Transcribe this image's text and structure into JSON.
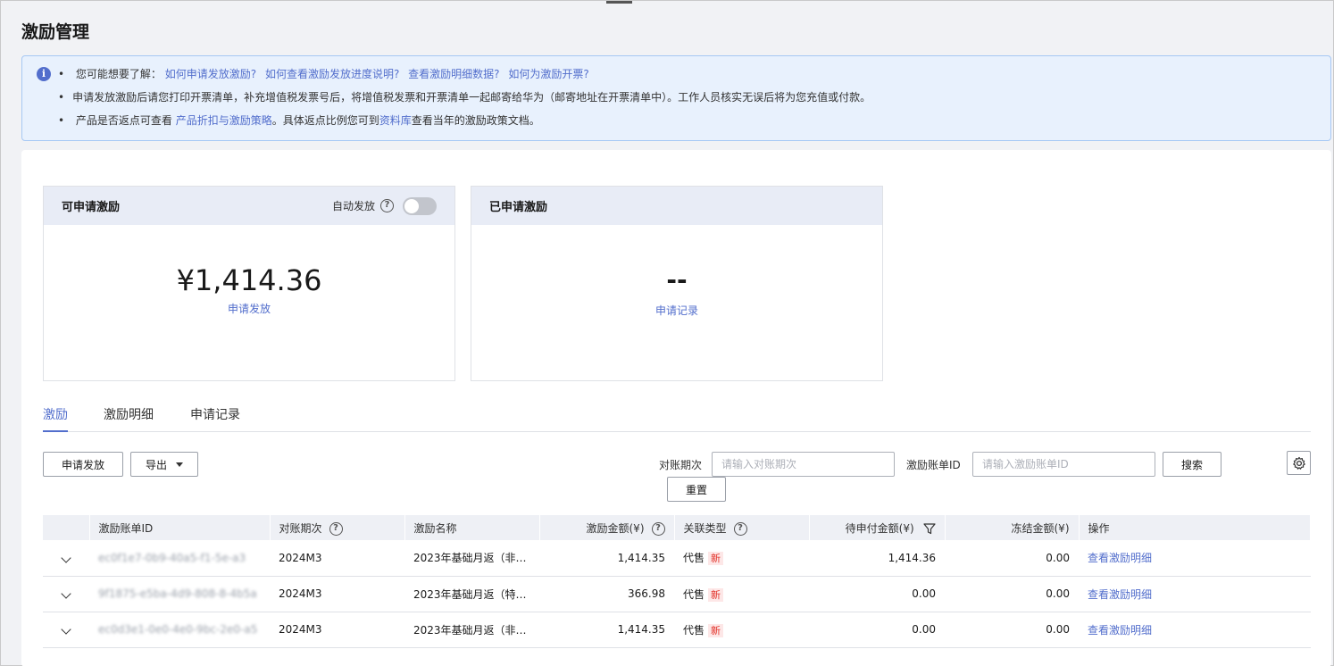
{
  "page": {
    "title": "激励管理"
  },
  "notice": {
    "line1_prefix": "您可能想要了解：",
    "links": [
      "如何申请发放激励?",
      "如何查看激励发放进度说明?",
      "查看激励明细数据?",
      "如何为激励开票?"
    ],
    "line2": "申请发放激励后请您打印开票清单，补充增值税发票号后，将增值税发票和开票清单一起邮寄给华为（邮寄地址在开票清单中）。工作人员核实无误后将为您充值或付款。",
    "line3_a": "产品是否返点可查看 ",
    "line3_link1": "产品折扣与激励策略",
    "line3_b": "。具体返点比例您可到",
    "line3_link2": "资料库",
    "line3_c": "查看当年的激励政策文档。"
  },
  "available_card": {
    "title": "可申请激励",
    "auto_label": "自动发放",
    "auto_enabled": false,
    "amount": "¥1,414.36",
    "action": "申请发放"
  },
  "applied_card": {
    "title": "已申请激励",
    "amount": "--",
    "action": "申请记录"
  },
  "tabs": [
    "激励",
    "激励明细",
    "申请记录"
  ],
  "toolbar": {
    "apply_button": "申请发放",
    "export_button": "导出",
    "period_label": "对账期次",
    "period_placeholder": "请输入对账期次",
    "bill_id_label": "激励账单ID",
    "bill_id_placeholder": "请输入激励账单ID",
    "search_button": "搜索",
    "reset_button": "重置"
  },
  "table": {
    "headers": [
      "激励账单ID",
      "对账期次",
      "激励名称",
      "激励金额(¥)",
      "关联类型",
      "待申付金额(¥)",
      "冻结金额(¥)",
      "操作"
    ],
    "rows": [
      {
        "id": "ec0f1e7-0b9-40a5-f1-5e-a3",
        "period": "2024M3",
        "name": "2023年基础月返（非…",
        "amount": "1,414.35",
        "type": "代售",
        "tag": "新",
        "pending": "1,414.36",
        "frozen": "0.00",
        "action": "查看激励明细"
      },
      {
        "id": "9f1875-e5ba-4d9-808-8-4b5a",
        "period": "2024M3",
        "name": "2023年基础月返（特…",
        "amount": "366.98",
        "type": "代售",
        "tag": "新",
        "pending": "0.00",
        "frozen": "0.00",
        "action": "查看激励明细"
      },
      {
        "id": "ec0d3e1-0e0-4e0-9bc-2e0-a5",
        "period": "2024M3",
        "name": "2023年基础月返（非…",
        "amount": "1,414.35",
        "type": "代售",
        "tag": "新",
        "pending": "0.00",
        "frozen": "0.00",
        "action": "查看激励明细"
      }
    ]
  },
  "colors": {
    "accent": "#526ecc",
    "tag_bg": "#fde7e7",
    "tag_text": "#e2332a",
    "notice_bg": "#e8f1fd"
  }
}
